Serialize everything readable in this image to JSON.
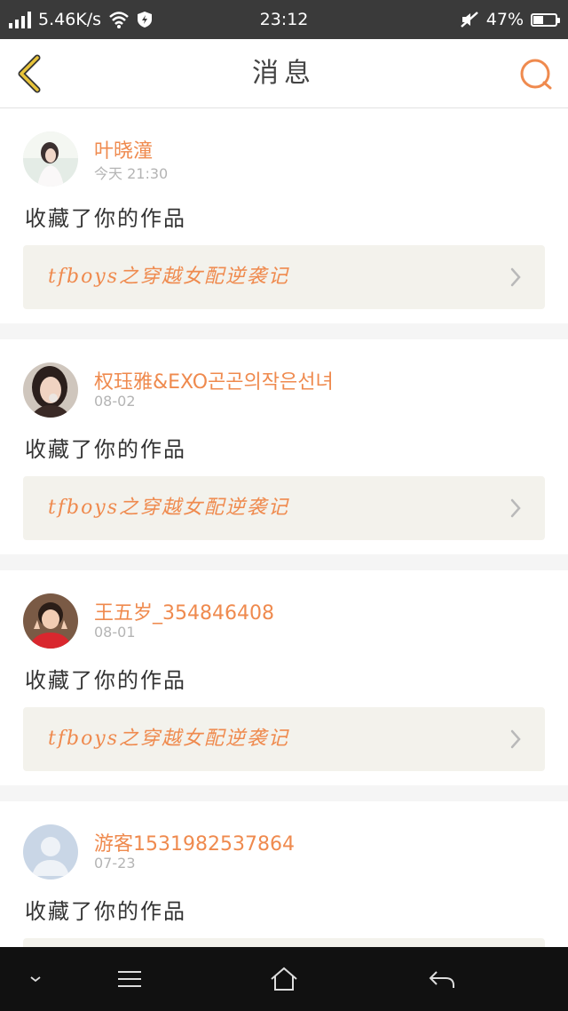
{
  "status_bar": {
    "network_speed": "5.46K/s",
    "time": "23:12",
    "battery_percent": "47%",
    "battery_level": 0.47,
    "icons": [
      "signal-icon",
      "wifi-icon",
      "shield-icon",
      "mute-icon",
      "battery-icon"
    ]
  },
  "header": {
    "title": "消息",
    "back_icon": "chevron-left-icon",
    "search_icon": "search-icon"
  },
  "messages": [
    {
      "name": "叶晓潼",
      "time": "今天 21:30",
      "action": "收藏了你的作品",
      "work_title": "tfboys之穿越女配逆袭记"
    },
    {
      "name": "权珏雅&EXO곤곤의작은선녀",
      "time": "08-02",
      "action": "收藏了你的作品",
      "work_title": "tfboys之穿越女配逆袭记"
    },
    {
      "name": "王五岁_354846408",
      "time": "08-01",
      "action": "收藏了你的作品",
      "work_title": "tfboys之穿越女配逆袭记"
    },
    {
      "name": "游客1531982537864",
      "time": "07-23",
      "action": "收藏了你的作品",
      "work_title": ""
    }
  ],
  "nav_bar": {
    "icons": [
      "chevron-down-icon",
      "menu-icon",
      "home-icon",
      "back-icon"
    ]
  },
  "colors": {
    "accent": "#ef8a4e",
    "back_arrow": "#e8c43a",
    "status_bar": "#3a3a3a"
  }
}
